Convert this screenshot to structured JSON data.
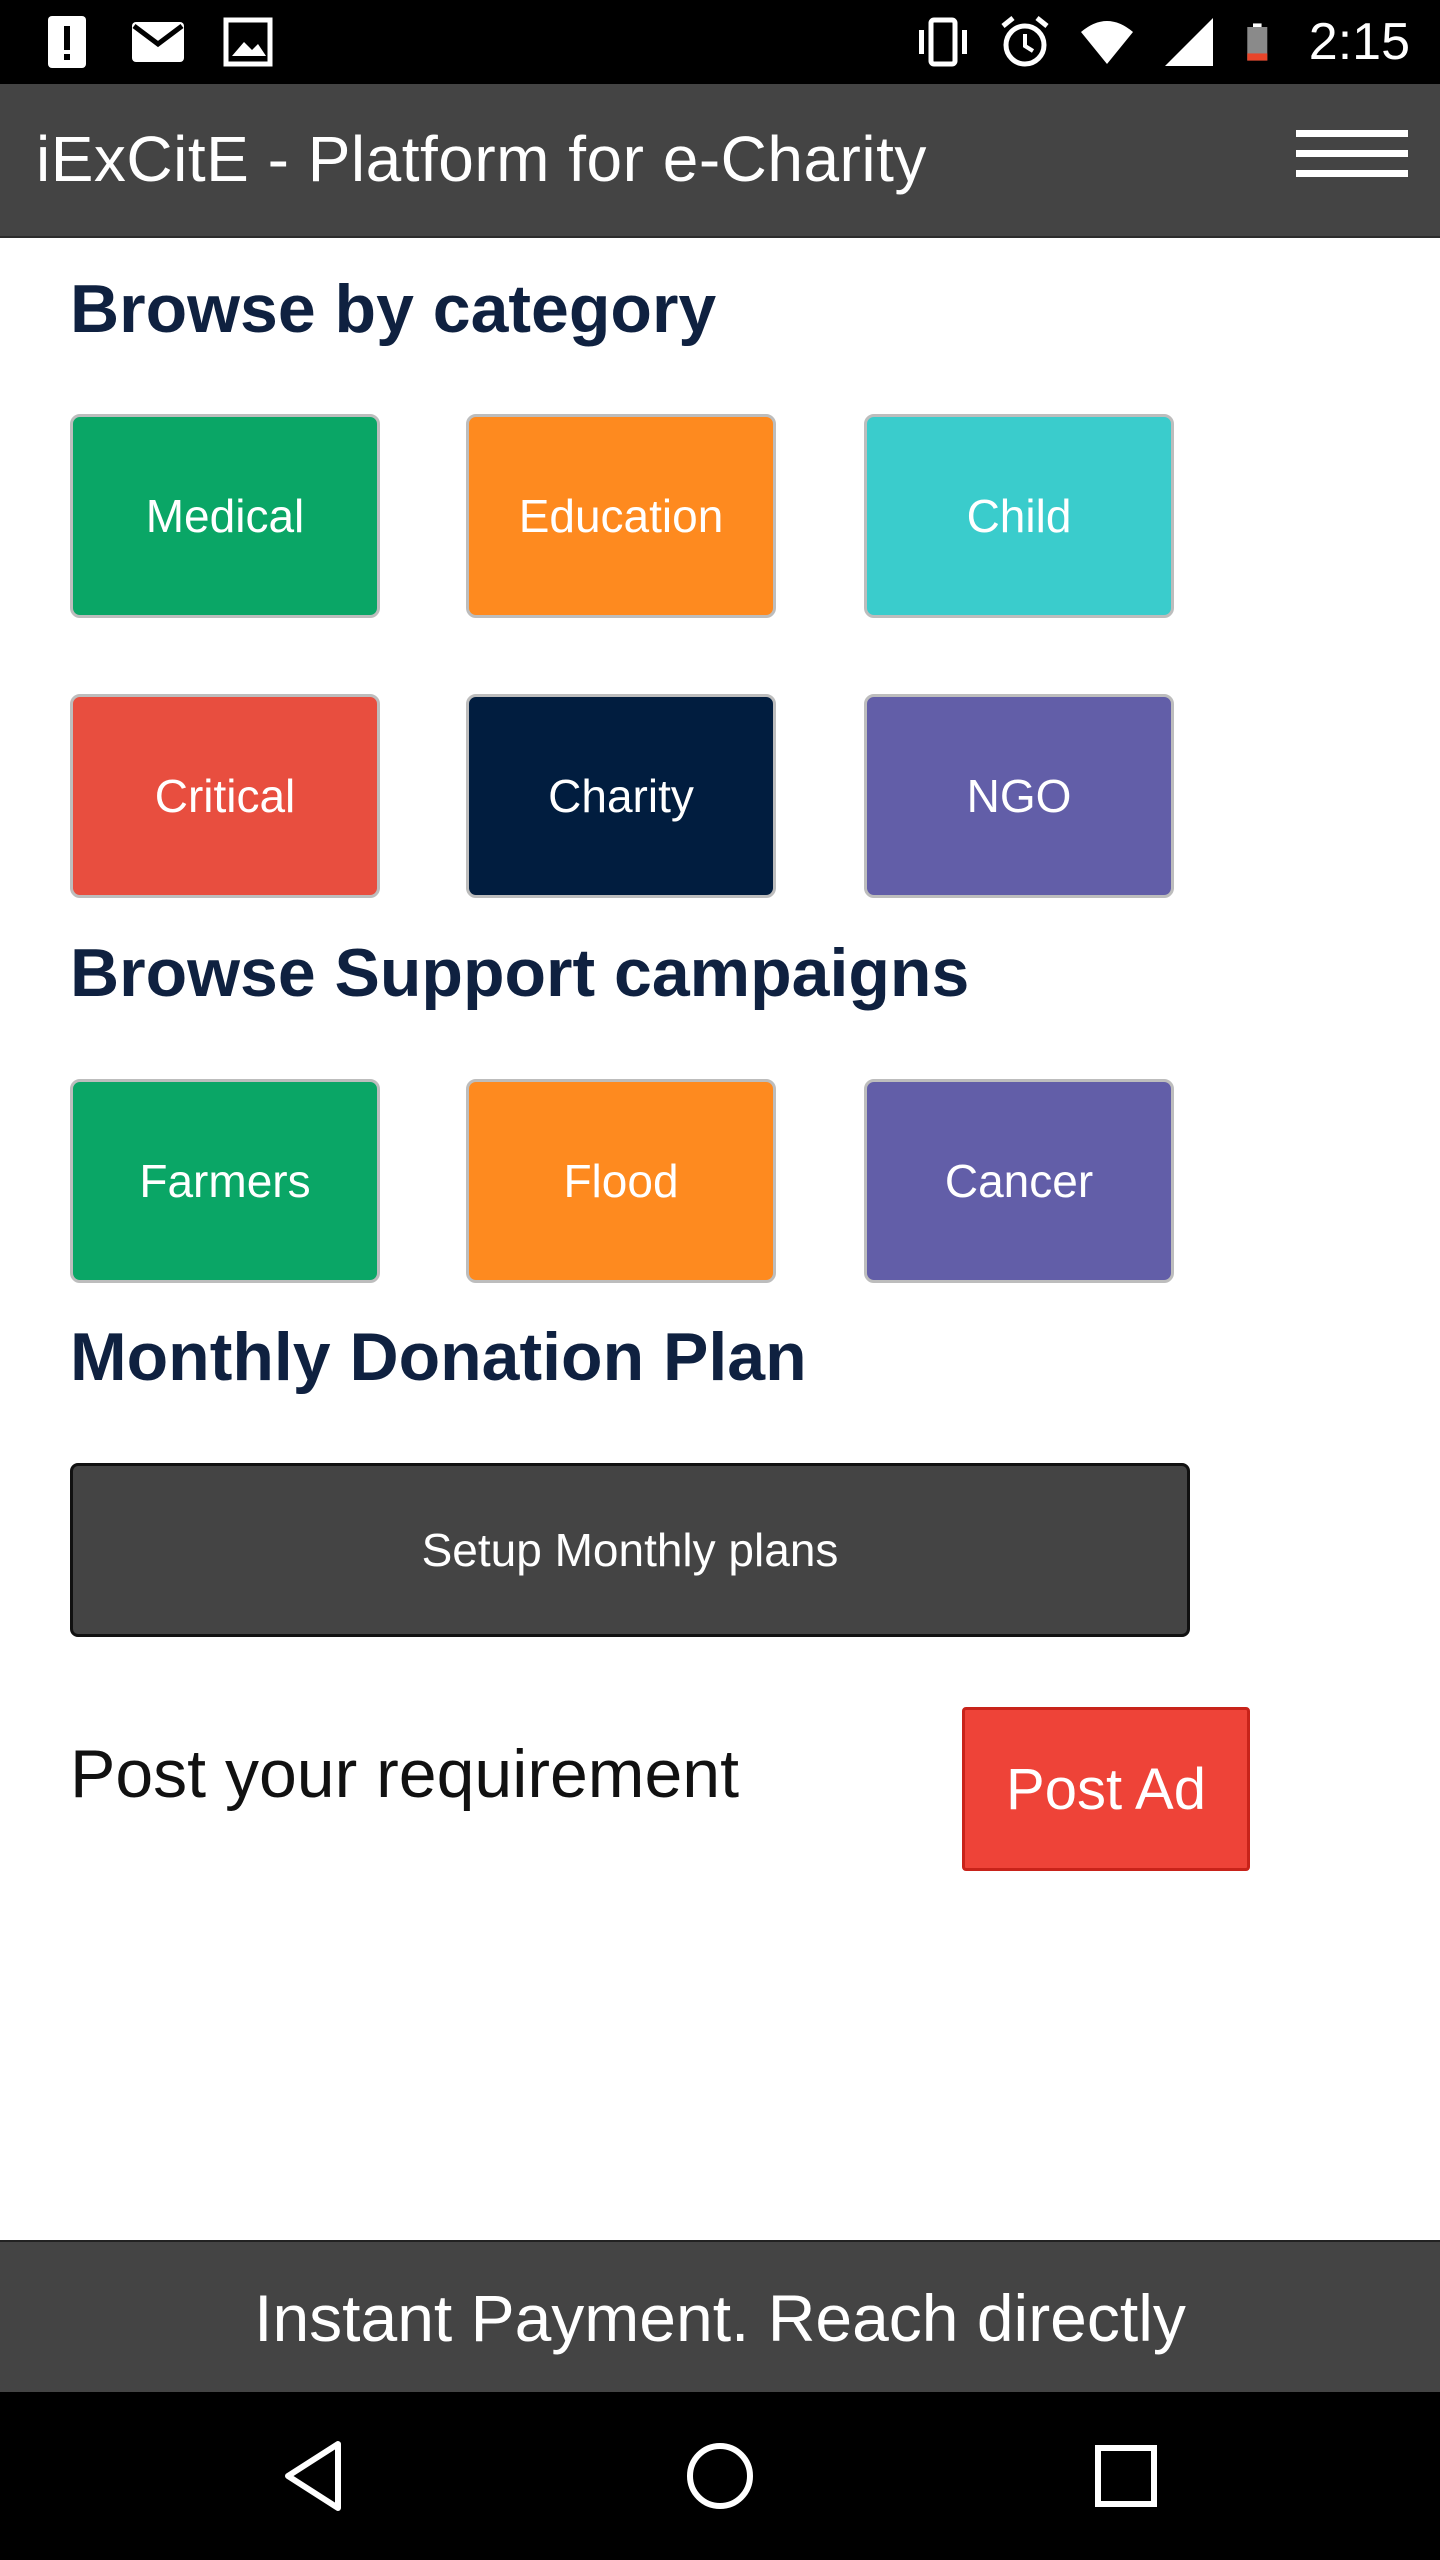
{
  "status_bar": {
    "time": "2:15",
    "left_icons": [
      "alert-icon",
      "mail-icon",
      "image-icon"
    ],
    "right_icons": [
      "vibrate-icon",
      "alarm-icon",
      "wifi-icon",
      "signal-icon",
      "battery-icon"
    ]
  },
  "app_bar": {
    "title": "iExCitE - Platform for e-Charity",
    "menu_icon": "hamburger-menu-icon"
  },
  "categories": {
    "heading": "Browse by category",
    "items": [
      {
        "label": "Medical",
        "color": "#0aa666"
      },
      {
        "label": "Education",
        "color": "#fe8a1f"
      },
      {
        "label": "Child",
        "color": "#3acccc"
      },
      {
        "label": "Critical",
        "color": "#e84e3f"
      },
      {
        "label": "Charity",
        "color": "#011d3f"
      },
      {
        "label": "NGO",
        "color": "#625ea8"
      }
    ]
  },
  "campaigns": {
    "heading": "Browse Support campaigns",
    "items": [
      {
        "label": "Farmers",
        "color": "#0aa666"
      },
      {
        "label": "Flood",
        "color": "#fe8a1f"
      },
      {
        "label": "Cancer",
        "color": "#625ea8"
      }
    ]
  },
  "monthly": {
    "heading": "Monthly Donation Plan",
    "button_label": "Setup Monthly plans"
  },
  "post": {
    "label": "Post your requirement",
    "button_label": "Post Ad",
    "button_color": "#ee4338"
  },
  "footer": {
    "text": "Instant Payment. Reach directly"
  },
  "nav_bar": {
    "icons": [
      "back-icon",
      "home-icon",
      "recents-icon"
    ]
  }
}
